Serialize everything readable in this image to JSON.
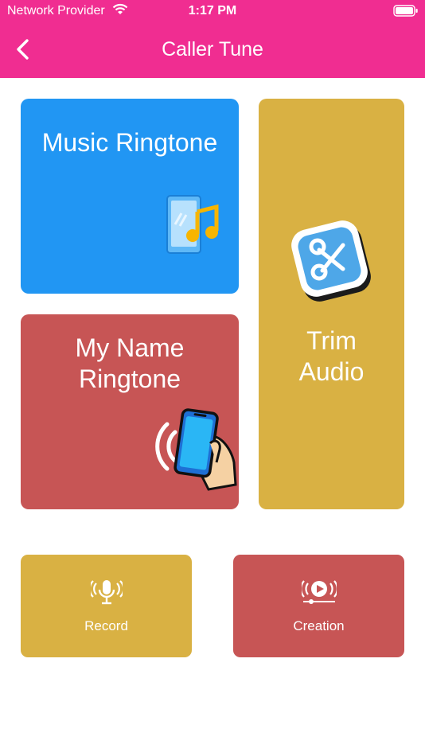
{
  "status_bar": {
    "carrier": "Network Provider",
    "time": "1:17 PM"
  },
  "header": {
    "title": "Caller Tune"
  },
  "cards": {
    "music_ringtone": {
      "label": "Music Ringtone",
      "color": "#2196f3"
    },
    "my_name_ringtone": {
      "line1": "My Name",
      "line2": "Ringtone",
      "color": "#c75555"
    },
    "trim_audio": {
      "line1": "Trim",
      "line2": "Audio",
      "color": "#d9b143"
    },
    "record": {
      "label": "Record",
      "color": "#d9b143"
    },
    "creation": {
      "label": "Creation",
      "color": "#c75555"
    }
  },
  "icons": [
    "wifi-icon",
    "battery-icon",
    "back-arrow-icon",
    "phone-music-icon",
    "hand-phone-ringing-icon",
    "scissors-icon",
    "microphone-icon",
    "video-creation-icon"
  ],
  "colors": {
    "header": "#f02d91",
    "background": "#ffffff"
  }
}
